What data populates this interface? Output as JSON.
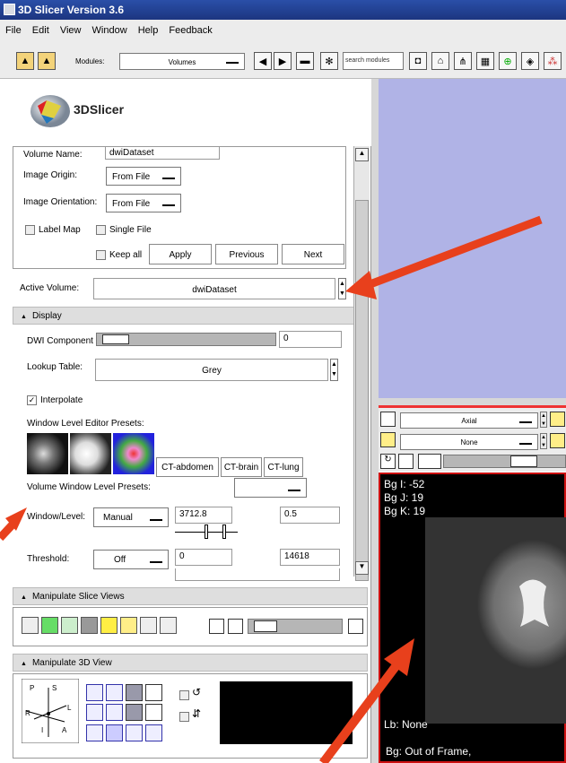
{
  "window": {
    "title": "3D Slicer Version 3.6"
  },
  "menu": [
    "File",
    "Edit",
    "View",
    "Window",
    "Help",
    "Feedback"
  ],
  "toolbar": {
    "modules_label": "Modules:",
    "module_value": "Volumes",
    "search_placeholder": "search modules"
  },
  "logo": {
    "text": "3DSlicer"
  },
  "io": {
    "volume_name_label": "Volume Name:",
    "volume_name_value": "dwiDataset",
    "image_origin_label": "Image Origin:",
    "image_origin_value": "From File",
    "image_orientation_label": "Image Orientation:",
    "image_orientation_value": "From File",
    "label_map": "Label Map",
    "single_file": "Single File",
    "keep_all": "Keep all",
    "apply": "Apply",
    "previous": "Previous",
    "next": "Next"
  },
  "active_volume": {
    "label": "Active Volume:",
    "value": "dwiDataset"
  },
  "display": {
    "header": "Display",
    "dwi_component_label": "DWI Component",
    "dwi_component_value": "0",
    "lookup_table_label": "Lookup Table:",
    "lookup_table_value": "Grey",
    "interpolate": "Interpolate",
    "wl_presets_label": "Window Level Editor Presets:",
    "presets": [
      "CT-abdomen",
      "CT-brain",
      "CT-lung"
    ],
    "volume_wl_presets_label": "Volume Window Level Presets:",
    "window_level_label": "Window/Level:",
    "window_level_mode": "Manual",
    "window_value": "3712.8",
    "level_value": "0.5",
    "threshold_label": "Threshold:",
    "threshold_mode": "Off",
    "threshold_low": "0",
    "threshold_high": "14618"
  },
  "manipulate_slice": {
    "header": "Manipulate Slice Views"
  },
  "manipulate_3d": {
    "header": "Manipulate 3D View",
    "axes": [
      "P",
      "S",
      "R",
      "L",
      "I",
      "A"
    ]
  },
  "slice_view": {
    "orientation": "Axial",
    "fg": "None",
    "bg_i": "Bg I: -52",
    "bg_j": "Bg J: 19",
    "bg_k": "Bg K: 19",
    "lb": "Lb: None",
    "bg_status": "Bg: Out of Frame,"
  },
  "colors": {
    "arrow": "#e8401c",
    "view3d": "#b0b3e6",
    "slice_border": "#cc1111"
  }
}
